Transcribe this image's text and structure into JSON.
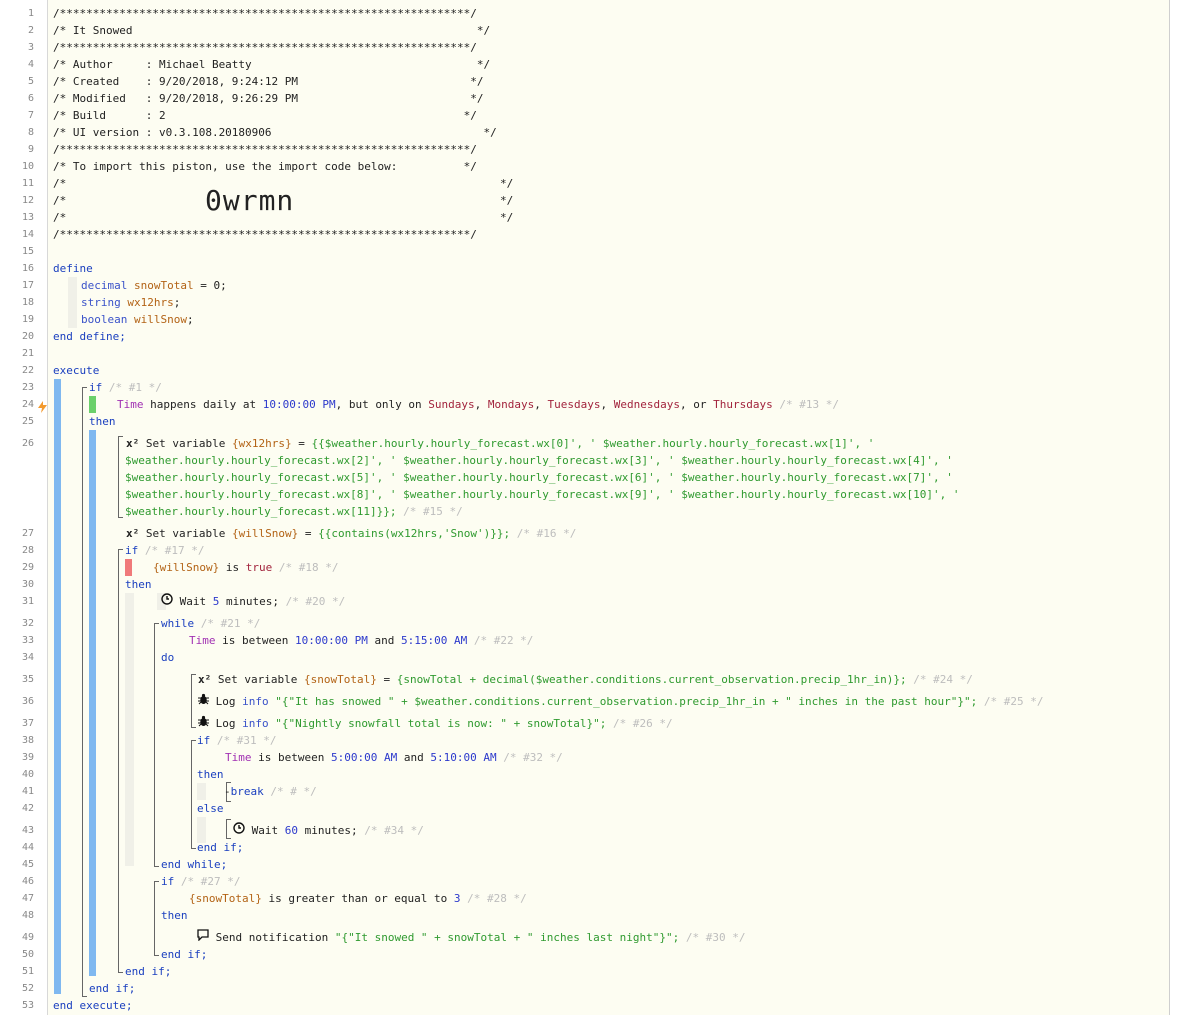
{
  "line_numbers": [
    "1",
    "2",
    "3",
    "4",
    "5",
    "6",
    "7",
    "8",
    "9",
    "10",
    "11",
    "12",
    "13",
    "14",
    "15",
    "16",
    "17",
    "18",
    "19",
    "20",
    "21",
    "22",
    "23",
    "24",
    "25",
    "26",
    "27",
    "28",
    "29",
    "30",
    "31",
    "32",
    "33",
    "34",
    "35",
    "36",
    "37",
    "38",
    "39",
    "40",
    "41",
    "42",
    "43",
    "44",
    "45",
    "46",
    "47",
    "48",
    "49",
    "50",
    "51",
    "52",
    "53"
  ],
  "header": {
    "border": "/**************************************************************/",
    "title": "/* It Snowed                                                    */",
    "author": "/* Author     : Michael Beatty                                  */",
    "created": "/* Created    : 9/20/2018, 9:24:12 PM                          */",
    "modified": "/* Modified   : 9/20/2018, 9:26:29 PM                          */",
    "build": "/* Build      : 2                                             */",
    "ui_version": "/* UI version : v0.3.108.20180906                                */",
    "import_note": "/* To import this piston, use the import code below:          */",
    "blank_open": "/*",
    "blank_close": "*/",
    "import_code": "0wrmn"
  },
  "kw": {
    "define": "define",
    "end_define": "end define;",
    "execute": "execute",
    "end_execute": "end execute;",
    "if": "if",
    "then": "then",
    "else": "else",
    "end_if": "end if;",
    "while": "while",
    "do": "do",
    "end_while": "end while;",
    "break": "break"
  },
  "vars": {
    "decimal": "decimal",
    "snowTotal": "snowTotal",
    "eq0": " = 0;",
    "string": "string",
    "wx12hrs": "wx12hrs",
    "boolean": "boolean",
    "willSnow": "willSnow",
    "semi": ";"
  },
  "stmts": {
    "c1": "/* #1 */",
    "time": "Time",
    "happens": " happens daily at ",
    "t1000": "10:00:00 PM",
    "only_on": ", but only on ",
    "sundays": "Sundays",
    "mondays": "Mondays",
    "tuesdays": "Tuesdays",
    "wednesdays": "Wednesdays",
    "thursdays": "Thursdays",
    "comma": ", ",
    "or": ", or ",
    "c13": "/* #13 */",
    "x2": "x²",
    "set_variable": " Set variable ",
    "wx12hrs_var": "{wx12hrs}",
    "assign": " = ",
    "expr26a": "{{$weather.hourly.hourly_forecast.wx[0]', ' $weather.hourly.hourly_forecast.wx[1]', '",
    "expr26b": "$weather.hourly.hourly_forecast.wx[2]', ' $weather.hourly.hourly_forecast.wx[3]', ' $weather.hourly.hourly_forecast.wx[4]', '",
    "expr26c": "$weather.hourly.hourly_forecast.wx[5]', ' $weather.hourly.hourly_forecast.wx[6]', ' $weather.hourly.hourly_forecast.wx[7]', '",
    "expr26d": "$weather.hourly.hourly_forecast.wx[8]', ' $weather.hourly.hourly_forecast.wx[9]', ' $weather.hourly.hourly_forecast.wx[10]', '",
    "expr26e": "$weather.hourly.hourly_forecast.wx[11]}};",
    "c15": "/* #15 */",
    "willSnow_var": "{willSnow}",
    "expr27": "{{contains(wx12hrs,'Snow')}};",
    "c16": "/* #16 */",
    "c17": "/* #17 */",
    "is": " is ",
    "true": "true",
    "c18": "/* #18 */",
    "wait": " Wait ",
    "five": "5",
    "minutes": " minutes;",
    "c20": "/* #20 */",
    "c21": "/* #21 */",
    "is_between": " is between ",
    "and": " and ",
    "t1000b": "10:00:00 PM",
    "t515": "5:15:00 AM",
    "c22": "/* #22 */",
    "snowTotal_var": "{snowTotal}",
    "expr35": "{snowTotal + decimal($weather.conditions.current_observation.precip_1hr_in)};",
    "c24": "/* #24 */",
    "log": " Log ",
    "info": "info",
    "expr36": "\"{\"It has snowed \" + $weather.conditions.current_observation.precip_1hr_in + \" inches in the past hour\"}\";",
    "c25": "/* #25 */",
    "expr37": "\"{\"Nightly snowfall total is now: \" + snowTotal}\";",
    "c26": "/* #26 */",
    "c31": "/* #31 */",
    "t500": "5:00:00 AM",
    "t510": "5:10:00 AM",
    "c32": "/* #32 */",
    "dash": "-",
    "chash": "/* # */",
    "sixty": "60",
    "c34": "/* #34 */",
    "c27": "/* #27 */",
    "gte": " is greater than or equal to ",
    "three": "3",
    "c28": "/* #28 */",
    "send_notification": " Send notification ",
    "expr49": "\"{\"It snowed \" + snowTotal + \" inches last night\"}\";",
    "c30": "/* #30 */"
  }
}
